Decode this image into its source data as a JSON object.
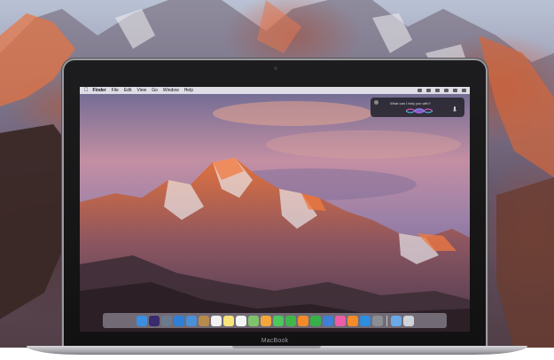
{
  "menubar": {
    "apple_icon": "apple-icon",
    "items": [
      "Finder",
      "File",
      "Edit",
      "View",
      "Go",
      "Window",
      "Help"
    ],
    "status_icons": [
      "wifi-icon",
      "battery-icon",
      "clock-icon",
      "search-icon",
      "siri-icon",
      "menu-icon"
    ]
  },
  "siri": {
    "prompt": "What can I help you with?",
    "close_icon": "close-icon",
    "mic_icon": "microphone-icon"
  },
  "dock": {
    "apps": [
      {
        "name": "finder",
        "color": "#3b8ee0"
      },
      {
        "name": "siri",
        "color": "#3a2a6e"
      },
      {
        "name": "launchpad",
        "color": "#6c7a8e"
      },
      {
        "name": "safari",
        "color": "#2f7fd8"
      },
      {
        "name": "mail",
        "color": "#4a90d9"
      },
      {
        "name": "contacts",
        "color": "#b88a4e"
      },
      {
        "name": "calendar",
        "color": "#f2f2f2"
      },
      {
        "name": "notes",
        "color": "#f6e37a"
      },
      {
        "name": "reminders",
        "color": "#f4f4f4"
      },
      {
        "name": "maps",
        "color": "#7fc46a"
      },
      {
        "name": "photos",
        "color": "#f4a63c"
      },
      {
        "name": "messages",
        "color": "#4cc85d"
      },
      {
        "name": "facetime",
        "color": "#3fb64a"
      },
      {
        "name": "pages",
        "color": "#f28a2a"
      },
      {
        "name": "numbers",
        "color": "#38b04a"
      },
      {
        "name": "keynote",
        "color": "#3f7fd6"
      },
      {
        "name": "itunes",
        "color": "#ee5ca8"
      },
      {
        "name": "ibooks",
        "color": "#f58a2a"
      },
      {
        "name": "app-store",
        "color": "#2d8de0"
      },
      {
        "name": "system-preferences",
        "color": "#8c8c94"
      }
    ],
    "right_items": [
      {
        "name": "downloads-folder",
        "color": "#6aa9e8"
      },
      {
        "name": "trash",
        "color": "#cfd3da"
      }
    ]
  },
  "device": {
    "brand": "MacBook"
  }
}
